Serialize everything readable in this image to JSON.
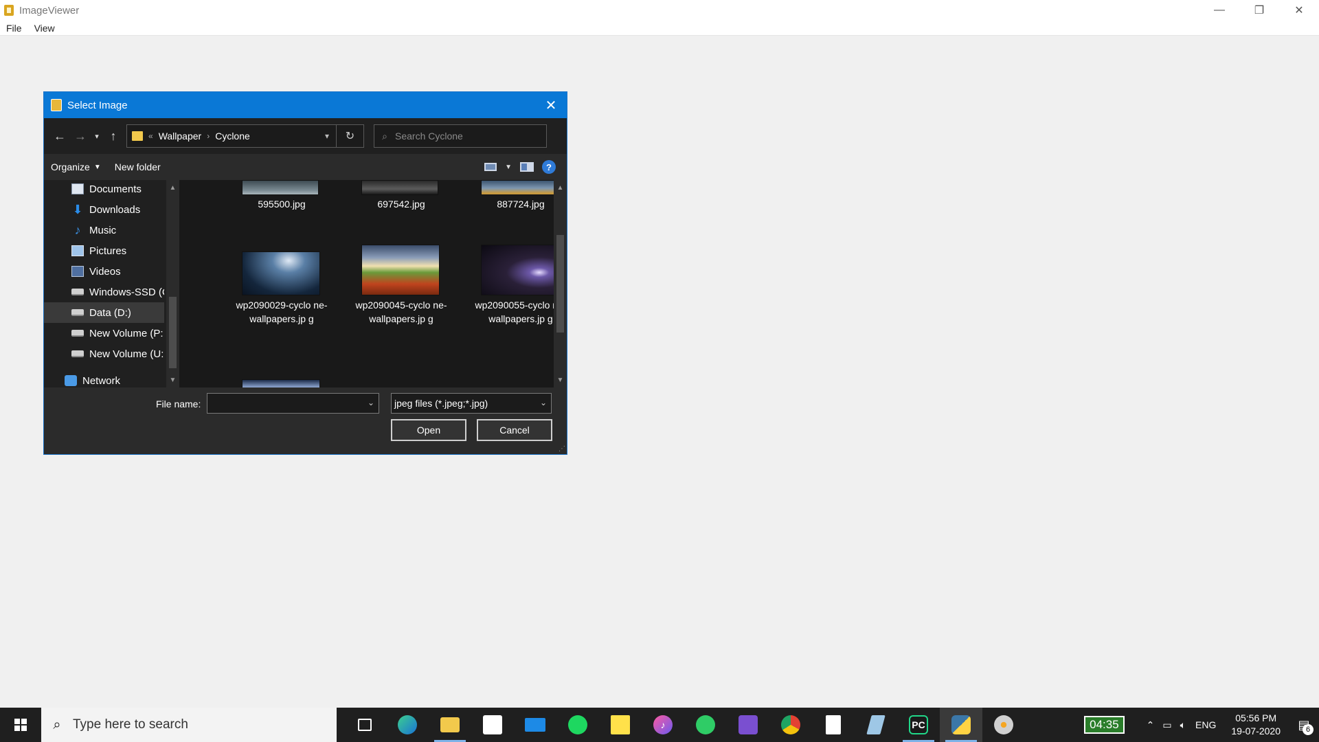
{
  "app": {
    "title": "ImageViewer",
    "menu": [
      "File",
      "View"
    ],
    "window_controls": {
      "minimize": "—",
      "restore": "❐",
      "close": "✕"
    }
  },
  "dialog": {
    "title": "Select Image",
    "close_glyph": "✕",
    "nav": {
      "back": "←",
      "forward": "→",
      "recent": "▾",
      "up": "↑"
    },
    "breadcrumb": {
      "overflow": "«",
      "items": [
        "Wallpaper",
        "Cyclone"
      ],
      "separator": "›"
    },
    "refresh_glyph": "↻",
    "search": {
      "placeholder": "Search Cyclone"
    },
    "toolbar": {
      "organize": "Organize",
      "new_folder": "New folder",
      "help": "?"
    },
    "nav_pane": [
      {
        "label": "Documents",
        "icon": "documents-icon"
      },
      {
        "label": "Downloads",
        "icon": "downloads-icon"
      },
      {
        "label": "Music",
        "icon": "music-icon"
      },
      {
        "label": "Pictures",
        "icon": "pictures-icon"
      },
      {
        "label": "Videos",
        "icon": "videos-icon"
      },
      {
        "label": "Windows-SSD (C",
        "icon": "drive-icon"
      },
      {
        "label": "Data (D:)",
        "icon": "drive-icon",
        "selected": true
      },
      {
        "label": "New Volume (P:",
        "icon": "drive-icon"
      },
      {
        "label": "New Volume (U:",
        "icon": "drive-icon"
      },
      {
        "label": "Network",
        "icon": "network-icon"
      }
    ],
    "files": [
      {
        "name": "595500.jpg"
      },
      {
        "name": "697542.jpg"
      },
      {
        "name": "887724.jpg"
      },
      {
        "name": "wp2090029-cyclo ne-wallpapers.jp g"
      },
      {
        "name": "wp2090045-cyclo ne-wallpapers.jp g"
      },
      {
        "name": "wp2090055-cyclo ne-wallpapers.jp g"
      }
    ],
    "file_name_label": "File name:",
    "file_name_value": "",
    "file_type": "jpeg files (*.jpeg;*.jpg)",
    "open_label": "Open",
    "cancel_label": "Cancel"
  },
  "taskbar": {
    "search_placeholder": "Type here to search",
    "battery_time": "04:35",
    "language": "ENG",
    "time": "05:56 PM",
    "date": "19-07-2020",
    "notification_count": "6",
    "apps": [
      "task-view",
      "edge",
      "file-explorer",
      "store",
      "mail",
      "spotify",
      "sticky-notes",
      "itunes",
      "whatsapp",
      "visual-studio",
      "chrome",
      "notepad-doc",
      "pen-app",
      "pycharm",
      "python",
      "paint"
    ]
  },
  "colors": {
    "dialog_title": "#0a78d6",
    "dialog_bg": "#202020",
    "taskbar": "#1f1f1f",
    "battery": "#2a7d2a"
  }
}
